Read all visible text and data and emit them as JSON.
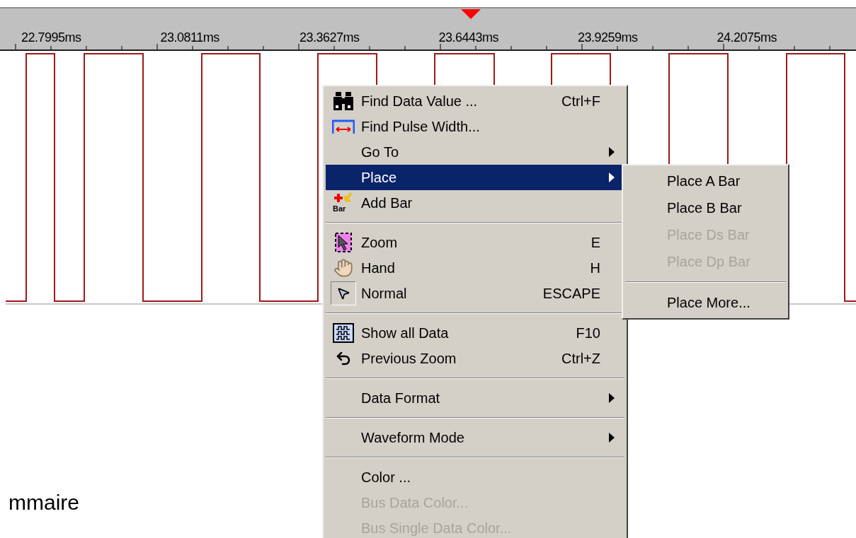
{
  "ruler": {
    "labels": [
      "22.7995ms",
      "23.0811ms",
      "23.3627ms",
      "23.6443ms",
      "23.9259ms",
      "24.2075ms"
    ]
  },
  "context_menu": {
    "items": [
      {
        "kind": "item",
        "label": "Find Data Value ...",
        "shortcut": "Ctrl+F",
        "submenu": false,
        "disabled": false,
        "selected": false,
        "checked": false
      },
      {
        "kind": "item",
        "label": "Find Pulse Width...",
        "submenu": false,
        "disabled": false,
        "selected": false,
        "checked": false
      },
      {
        "kind": "item",
        "label": "Go To",
        "submenu": true,
        "disabled": false,
        "selected": false,
        "checked": false
      },
      {
        "kind": "item",
        "label": "Place",
        "submenu": true,
        "disabled": false,
        "selected": true,
        "checked": false
      },
      {
        "kind": "item",
        "label": "Add Bar",
        "icon_label": "Bar",
        "submenu": false,
        "disabled": false,
        "selected": false,
        "checked": false
      },
      {
        "kind": "separator"
      },
      {
        "kind": "item",
        "label": "Zoom",
        "shortcut": "E",
        "submenu": false,
        "disabled": false,
        "selected": false,
        "checked": false
      },
      {
        "kind": "item",
        "label": "Hand",
        "shortcut": "H",
        "submenu": false,
        "disabled": false,
        "selected": false,
        "checked": false
      },
      {
        "kind": "item",
        "label": "Normal",
        "shortcut": "ESCAPE",
        "submenu": false,
        "disabled": false,
        "selected": false,
        "checked": true
      },
      {
        "kind": "separator"
      },
      {
        "kind": "item",
        "label": "Show all Data",
        "shortcut": "F10",
        "submenu": false,
        "disabled": false,
        "selected": false,
        "checked": false
      },
      {
        "kind": "item",
        "label": "Previous Zoom",
        "shortcut": "Ctrl+Z",
        "submenu": false,
        "disabled": false,
        "selected": false,
        "checked": false
      },
      {
        "kind": "separator"
      },
      {
        "kind": "item",
        "label": "Data Format",
        "submenu": true,
        "disabled": false,
        "selected": false,
        "checked": false
      },
      {
        "kind": "separator"
      },
      {
        "kind": "item",
        "label": "Waveform Mode",
        "submenu": true,
        "disabled": false,
        "selected": false,
        "checked": false
      },
      {
        "kind": "separator"
      },
      {
        "kind": "item",
        "label": "Color ...",
        "submenu": false,
        "disabled": false,
        "selected": false,
        "checked": false
      },
      {
        "kind": "item",
        "label": "Bus Data Color...",
        "submenu": false,
        "disabled": true,
        "selected": false,
        "checked": false
      },
      {
        "kind": "item",
        "label": "Bus Single Data Color...",
        "submenu": false,
        "disabled": true,
        "selected": false,
        "checked": false
      }
    ]
  },
  "submenu": {
    "items": [
      {
        "kind": "item",
        "label": "Place A Bar",
        "disabled": false,
        "selected": false
      },
      {
        "kind": "item",
        "label": "Place B Bar",
        "disabled": false,
        "selected": false
      },
      {
        "kind": "item",
        "label": "Place Ds Bar",
        "disabled": true,
        "selected": false
      },
      {
        "kind": "item",
        "label": "Place Dp Bar",
        "disabled": true,
        "selected": false
      },
      {
        "kind": "separator"
      },
      {
        "kind": "item",
        "label": "Place More...",
        "disabled": false,
        "selected": false
      }
    ]
  },
  "page_text": "mmaire"
}
